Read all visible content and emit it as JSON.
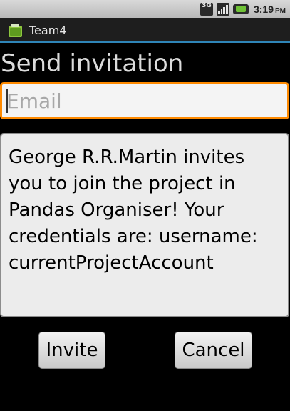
{
  "status_bar": {
    "network_label": "3G",
    "time": "3:19",
    "ampm": "PM",
    "icons": [
      "3g-icon",
      "signal-icon",
      "battery-icon"
    ]
  },
  "app": {
    "title": "Team4",
    "icon": "android-app-icon"
  },
  "form": {
    "heading": "Send invitation",
    "email_placeholder": "Email",
    "email_value": "",
    "message": "George R.R.Martin invites you to join the project in Pandas Organiser! Your credentials are: username: currentProjectAccount"
  },
  "buttons": {
    "invite_label": "Invite",
    "cancel_label": "Cancel"
  },
  "colors": {
    "focus_border": "#ff8a00",
    "title_underline": "#2f85b8",
    "background": "#000000"
  }
}
